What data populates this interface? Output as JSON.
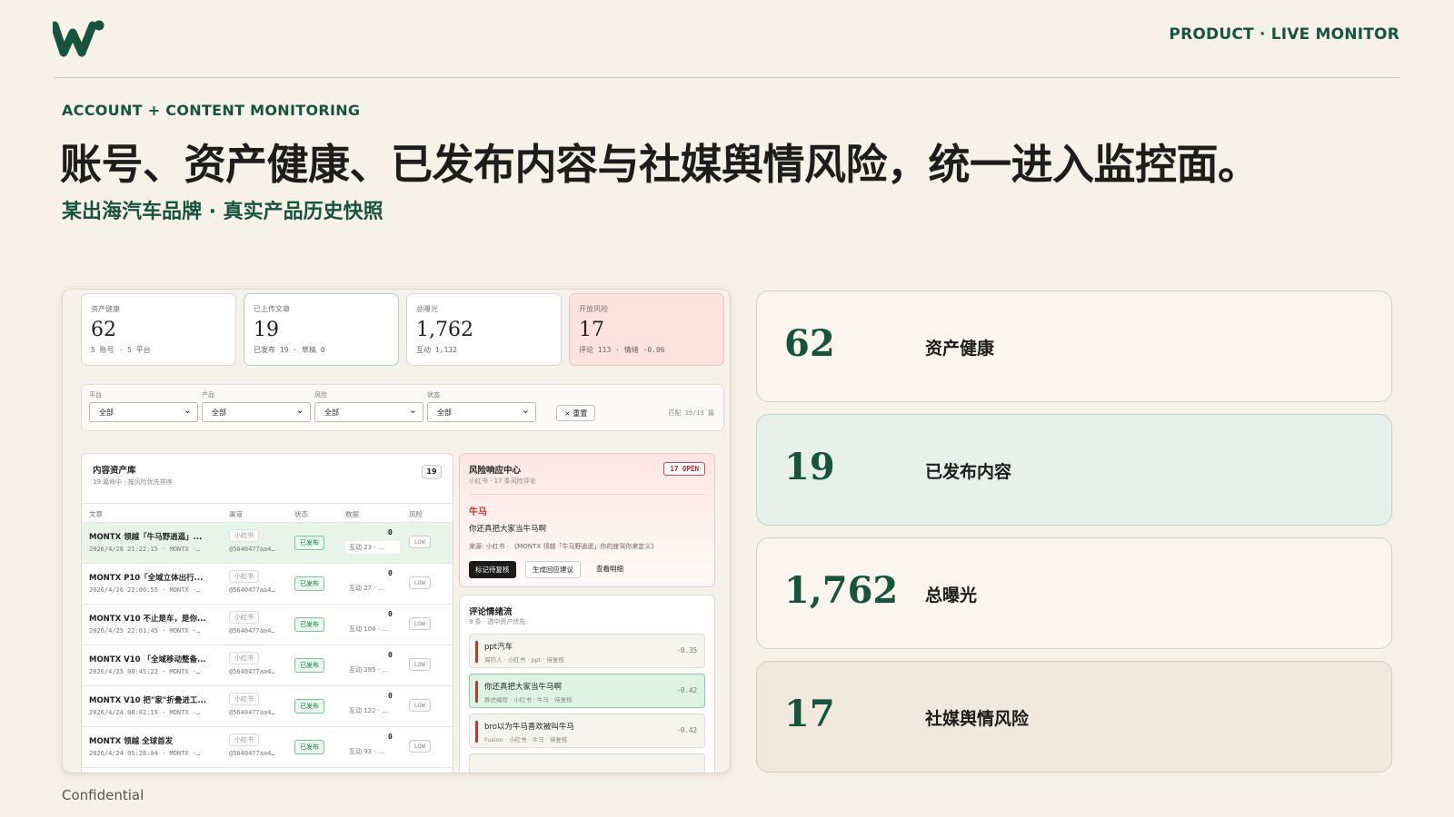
{
  "header": {
    "top_right": "PRODUCT · LIVE MONITOR"
  },
  "hero": {
    "eyebrow": "ACCOUNT + CONTENT MONITORING",
    "headline": "账号、资产健康、已发布内容与社媒舆情风险，统一进入监控面。",
    "subline": "某出海汽车品牌 · 真实产品历史快照"
  },
  "colors": {
    "brand_green": "#17533d",
    "risk_red": "#c0392b",
    "background": "#f7f2e8"
  },
  "dashboard": {
    "kpis": [
      {
        "label": "资产健康",
        "value": "62",
        "sub": "5 账号 · 5 平台"
      },
      {
        "label": "已上传文章",
        "value": "19",
        "sub": "已发布 19 · 草稿 0"
      },
      {
        "label": "总曝光",
        "value": "1,762",
        "sub": "互动 1,132"
      },
      {
        "label": "开放风险",
        "value": "17",
        "sub": "评论 113 · 情绪 -0.06"
      }
    ],
    "filters": [
      {
        "label": "平台",
        "value": "全部"
      },
      {
        "label": "产品",
        "value": "全部"
      },
      {
        "label": "风险",
        "value": "全部"
      },
      {
        "label": "状态",
        "value": "全部"
      }
    ],
    "reset_label": "× 重置",
    "match_text": "匹配 19/19 篇",
    "library": {
      "title": "内容资产库",
      "subtitle": "19 篇命中 · 按风险优先排序",
      "count": "19",
      "columns": [
        "文章",
        "渠道",
        "状态",
        "数据",
        "风险"
      ],
      "rows": [
        {
          "title": "MONTX 领越「牛马野逍遥」...",
          "meta": "2026/4/28 21:22:15 · MONTX ·…",
          "channel": "小红书",
          "account": "@5640477aa4…",
          "status": "已发布",
          "num": "0",
          "data": "互动 23 · …",
          "risk": "LOW"
        },
        {
          "title": "MONTX P10「全域立体出行...",
          "meta": "2026/4/26 22:00:55 · MONTX ·…",
          "channel": "小红书",
          "account": "@5640477aa4…",
          "status": "已发布",
          "num": "0",
          "data": "互动 27 · …",
          "risk": "LOW"
        },
        {
          "title": "MONTX V10 不止是车，是你...",
          "meta": "2026/4/25 22:01:45 · MONTX ·…",
          "channel": "小红书",
          "account": "@5640477aa4…",
          "status": "已发布",
          "num": "0",
          "data": "互动 108 · …",
          "risk": "LOW"
        },
        {
          "title": "MONTX V10 「全域移动整备...",
          "meta": "2026/4/25 00:45:22 · MONTX ·…",
          "channel": "小红书",
          "account": "@5640477aa4…",
          "status": "已发布",
          "num": "0",
          "data": "互动 295 · …",
          "risk": "LOW"
        },
        {
          "title": "MONTX V10 把\"家\"折叠进工...",
          "meta": "2026/4/24 08:02:19 · MONTX ·…",
          "channel": "小红书",
          "account": "@5640477aa4…",
          "status": "已发布",
          "num": "0",
          "data": "互动 122 · …",
          "risk": "LOW"
        },
        {
          "title": "MONTX 领越 全球首发",
          "meta": "2026/4/24 05:28:04 · MONTX ·…",
          "channel": "小红书",
          "account": "@5640477aa4…",
          "status": "已发布",
          "num": "0",
          "data": "互动 93 · …",
          "risk": "LOW"
        }
      ]
    },
    "risk_center": {
      "title": "风险响应中心",
      "subtitle": "小红书 · 17 条风险评论",
      "badge": "17 OPEN",
      "keyword": "牛马",
      "comment": "你还真把大家当牛马啊",
      "source": "来源: 小红书 · 《MONTX 领越「牛马野逍遥」你的座驾你来定义》",
      "btn_mark": "标记待复核",
      "btn_suggest": "生成回应建议",
      "btn_detail": "查看明细"
    },
    "emotion": {
      "title": "评论情绪流",
      "subtitle": "9 条 · 选中资产优先",
      "items": [
        {
          "text": "ppt汽车",
          "meta": "海钓人 · 小红书 · ppt · 待复核",
          "score": "-0.35"
        },
        {
          "text": "你还真把大家当牛马啊",
          "meta": "胖虎编程 · 小红书 · 牛马 · 待复核",
          "score": "-0.42"
        },
        {
          "text": "bro以为牛马喜欢被叫牛马",
          "meta": "Fusion · 小红书 · 牛马 · 待复核",
          "score": "-0.42"
        }
      ]
    }
  },
  "stats": [
    {
      "value": "62",
      "label": "资产健康"
    },
    {
      "value": "19",
      "label": "已发布内容"
    },
    {
      "value": "1,762",
      "label": "总曝光"
    },
    {
      "value": "17",
      "label": "社媒舆情风险"
    }
  ],
  "footer": {
    "text": "Confidential"
  }
}
